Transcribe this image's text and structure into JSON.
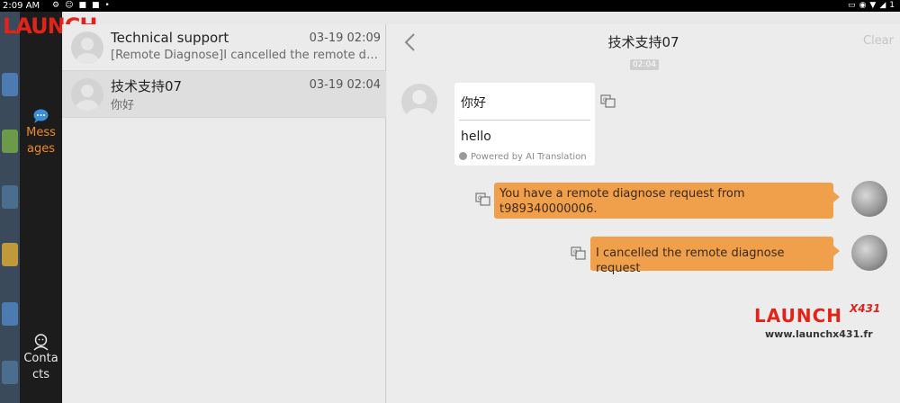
{
  "status_bar": {
    "time": "2:09 AM",
    "left_icons": [
      "gear-icon",
      "face-icon",
      "video-icon",
      "camcorder-icon",
      "dot-icon"
    ],
    "right_icons": [
      "cast-icon",
      "location-icon",
      "wifi-icon",
      "signal-icon"
    ],
    "right_text": "1"
  },
  "brand": {
    "logo_text": "LAUNCH"
  },
  "nav_rail": {
    "messages_label": "Mess\nages",
    "contacts_label": "Conta\ncts"
  },
  "conversations": [
    {
      "name": "Technical support",
      "date": "03-19 02:09",
      "preview": "[Remote Diagnose]I cancelled the remote diagnose request"
    },
    {
      "name": "技术支持07",
      "date": "03-19 02:04",
      "preview": "你好"
    }
  ],
  "chat": {
    "title": "技术支持07",
    "clear_label": "Clear",
    "timestamp": "02:04",
    "incoming": {
      "original": "你好",
      "translated": "hello",
      "powered_by": "Powered by AI Translation"
    },
    "outgoing": [
      {
        "text": "You have a remote diagnose request from t989340000006."
      },
      {
        "text": "I cancelled the remote diagnose request"
      }
    ]
  },
  "watermark": {
    "logo": "LAUNCH",
    "model": "X431",
    "url": "www.launchx431.fr"
  },
  "colors": {
    "accent": "#f08a24",
    "bubble_out": "#f0a04b",
    "brand_red": "#e2231a",
    "rail_bg": "#1c1c1c"
  }
}
